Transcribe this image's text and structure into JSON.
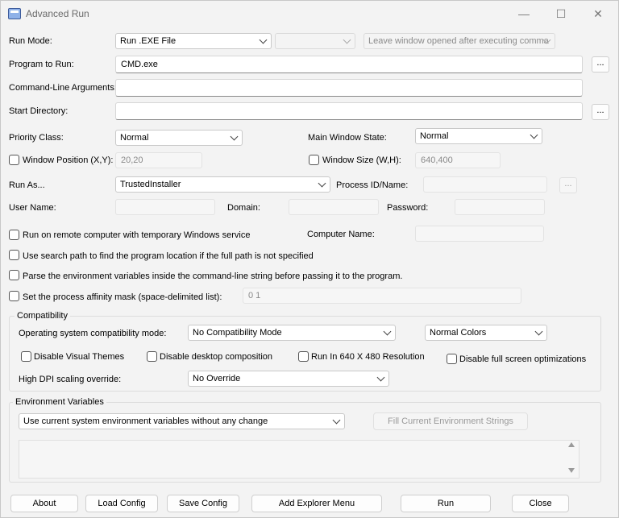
{
  "window": {
    "title": "Advanced Run",
    "minimize": "—",
    "maximize": "☐",
    "close": "✕"
  },
  "run_mode": {
    "label": "Run Mode:",
    "value": "Run .EXE File",
    "secondary": "",
    "leave_window": "Leave window opened after executing comma"
  },
  "program": {
    "label": "Program to Run:",
    "value": "CMD.exe",
    "browse": "..."
  },
  "args": {
    "label": "Command-Line Arguments:",
    "value": ""
  },
  "start_dir": {
    "label": "Start Directory:",
    "value": "",
    "browse": "..."
  },
  "priority": {
    "label": "Priority Class:",
    "value": "Normal"
  },
  "main_window_state": {
    "label": "Main Window State:",
    "value": "Normal"
  },
  "window_position": {
    "label": "Window Position (X,Y):",
    "value": "20,20"
  },
  "window_size": {
    "label": "Window Size (W,H):",
    "value": "640,400"
  },
  "run_as": {
    "label": "Run As...",
    "value": "TrustedInstaller",
    "process_label": "Process ID/Name:",
    "process_value": "",
    "browse": "..."
  },
  "credentials": {
    "user_label": "User Name:",
    "domain_label": "Domain:",
    "password_label": "Password:"
  },
  "remote": {
    "label": "Run on remote computer with temporary Windows service",
    "computer_label": "Computer Name:"
  },
  "options": {
    "search_path": "Use search path to find the program location if the full path is not specified",
    "parse_env": "Parse the environment variables inside the command-line string before passing it to the program.",
    "affinity": "Set the process affinity mask (space-delimited list):",
    "affinity_value": "0 1"
  },
  "compat": {
    "title": "Compatibility",
    "os_label": "Operating system compatibility mode:",
    "os_value": "No Compatibility Mode",
    "colors_value": "Normal Colors",
    "disable_themes": "Disable Visual Themes",
    "disable_composition": "Disable desktop composition",
    "run_640": "Run In 640 X 480 Resolution",
    "disable_fullscreen": "Disable full screen optimizations",
    "dpi_label": "High DPI scaling override:",
    "dpi_value": "No Override"
  },
  "env": {
    "title": "Environment Variables",
    "mode": "Use current system environment variables without any change",
    "fill_button": "Fill Current Environment Strings"
  },
  "buttons": {
    "about": "About",
    "load": "Load Config",
    "save": "Save Config",
    "explorer": "Add Explorer Menu",
    "run": "Run",
    "close": "Close"
  }
}
